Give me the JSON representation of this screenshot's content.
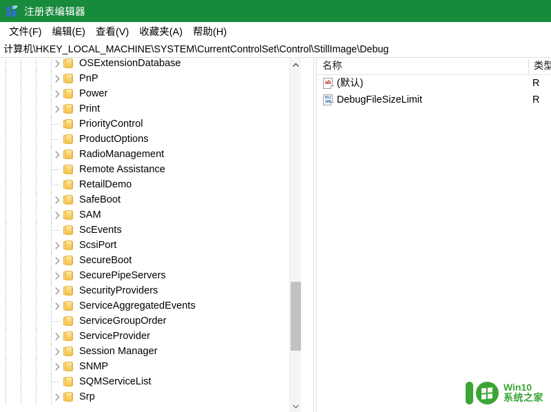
{
  "window": {
    "title": "注册表编辑器",
    "icon": "registry-editor-icon"
  },
  "menubar": {
    "items": [
      {
        "label": "文件(F)"
      },
      {
        "label": "编辑(E)"
      },
      {
        "label": "查看(V)"
      },
      {
        "label": "收藏夹(A)"
      },
      {
        "label": "帮助(H)"
      }
    ]
  },
  "address": {
    "path": "计算机\\HKEY_LOCAL_MACHINE\\SYSTEM\\CurrentControlSet\\Control\\StillImage\\Debug"
  },
  "tree": {
    "rows": [
      {
        "label": "OSExtensionDatabase",
        "expandable": true,
        "partial_top": false
      },
      {
        "label": "PnP",
        "expandable": true
      },
      {
        "label": "Power",
        "expandable": true
      },
      {
        "label": "Print",
        "expandable": true
      },
      {
        "label": "PriorityControl",
        "expandable": false
      },
      {
        "label": "ProductOptions",
        "expandable": false
      },
      {
        "label": "RadioManagement",
        "expandable": true
      },
      {
        "label": "Remote Assistance",
        "expandable": false
      },
      {
        "label": "RetailDemo",
        "expandable": false
      },
      {
        "label": "SafeBoot",
        "expandable": true
      },
      {
        "label": "SAM",
        "expandable": true
      },
      {
        "label": "ScEvents",
        "expandable": false
      },
      {
        "label": "ScsiPort",
        "expandable": true
      },
      {
        "label": "SecureBoot",
        "expandable": true
      },
      {
        "label": "SecurePipeServers",
        "expandable": true
      },
      {
        "label": "SecurityProviders",
        "expandable": true
      },
      {
        "label": "ServiceAggregatedEvents",
        "expandable": true
      },
      {
        "label": "ServiceGroupOrder",
        "expandable": false
      },
      {
        "label": "ServiceProvider",
        "expandable": true
      },
      {
        "label": "Session Manager",
        "expandable": true
      },
      {
        "label": "SNMP",
        "expandable": true
      },
      {
        "label": "SQMServiceList",
        "expandable": false
      },
      {
        "label": "Srp",
        "expandable": true
      }
    ]
  },
  "scrollbar": {
    "up_arrow": "chevron-up-icon",
    "down_arrow": "chevron-down-icon"
  },
  "list": {
    "columns": [
      {
        "key": "name",
        "label": "名称"
      },
      {
        "key": "type",
        "label": "类型"
      }
    ],
    "rows": [
      {
        "name": "(默认)",
        "type": "R",
        "icon": "string-value-icon",
        "icon_glyph": "ab",
        "icon_kind": "sz"
      },
      {
        "name": "DebugFileSizeLimit",
        "type": "R",
        "icon": "dword-value-icon",
        "icon_glyph": "011\n100",
        "icon_kind": "dw"
      }
    ]
  },
  "watermark": {
    "line1": "Win10",
    "line2": "系统之家"
  },
  "colors": {
    "titlebar": "#188a3c",
    "folder": "#fbd271",
    "string_icon": "#c0392b",
    "dword_icon": "#1f5fa8",
    "watermark": "#3aa535"
  }
}
